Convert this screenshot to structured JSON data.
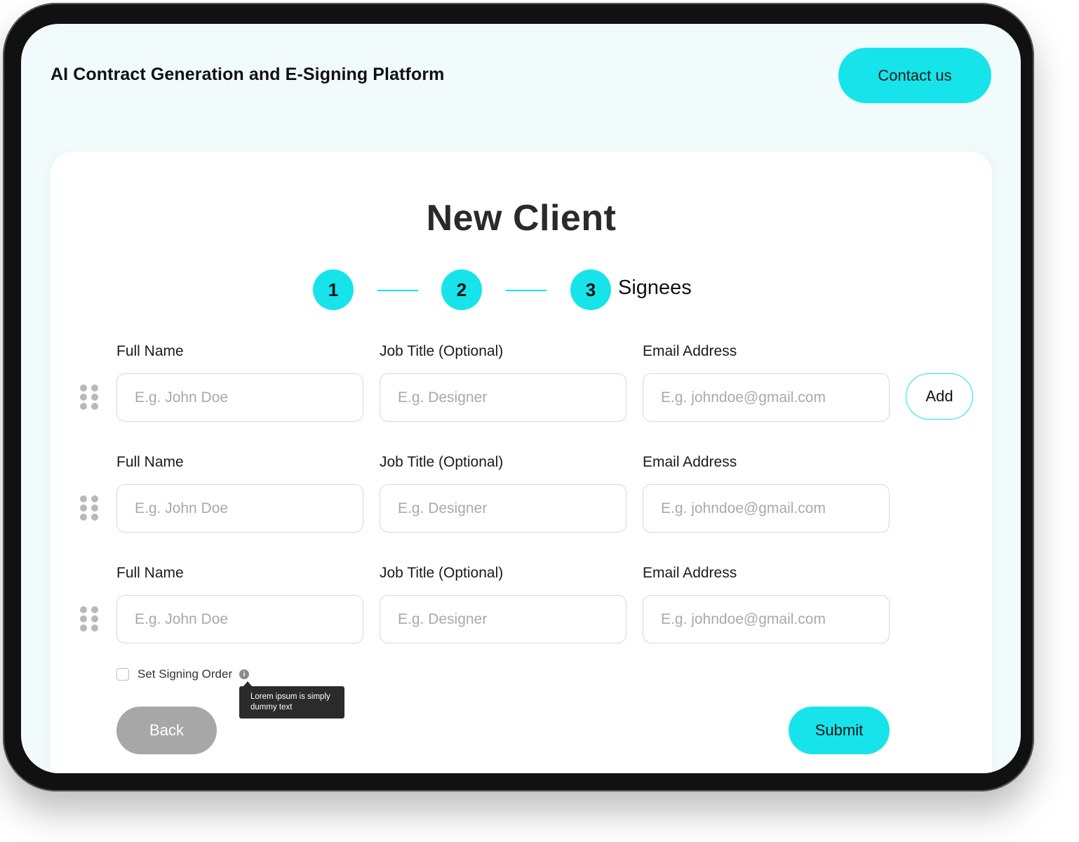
{
  "header": {
    "app_title": "AI Contract Generation and E-Signing Platform",
    "contact_label": "Contact us"
  },
  "form": {
    "title": "New Client",
    "steps": [
      {
        "number": "1",
        "label": ""
      },
      {
        "number": "2",
        "label": ""
      },
      {
        "number": "3",
        "label": "Signees"
      }
    ],
    "signees": [
      {
        "full_name_label": "Full Name",
        "full_name_placeholder": "E.g. John Doe",
        "full_name_value": "",
        "job_title_label": "Job Title (Optional)",
        "job_title_placeholder": "E.g. Designer",
        "job_title_value": "",
        "email_label": "Email Address",
        "email_placeholder": "E.g. johndoe@gmail.com",
        "email_value": ""
      },
      {
        "full_name_label": "Full Name",
        "full_name_placeholder": "E.g. John Doe",
        "full_name_value": "",
        "job_title_label": "Job Title (Optional)",
        "job_title_placeholder": "E.g. Designer",
        "job_title_value": "",
        "email_label": "Email Address",
        "email_placeholder": "E.g. johndoe@gmail.com",
        "email_value": ""
      },
      {
        "full_name_label": "Full Name",
        "full_name_placeholder": "E.g. John Doe",
        "full_name_value": "",
        "job_title_label": "Job Title (Optional)",
        "job_title_placeholder": "E.g. Designer",
        "job_title_value": "",
        "email_label": "Email Address",
        "email_placeholder": "E.g. johndoe@gmail.com",
        "email_value": ""
      }
    ],
    "add_label": "Add",
    "signing_order_label": "Set Signing Order",
    "signing_order_checked": false,
    "info_icon_glyph": "i",
    "tooltip_text": "Lorem ipsum is simply dummy text",
    "back_label": "Back",
    "submit_label": "Submit"
  },
  "colors": {
    "accent": "#17e4ea",
    "background": "#f2fbfc",
    "back_button": "#a7a7a7"
  }
}
